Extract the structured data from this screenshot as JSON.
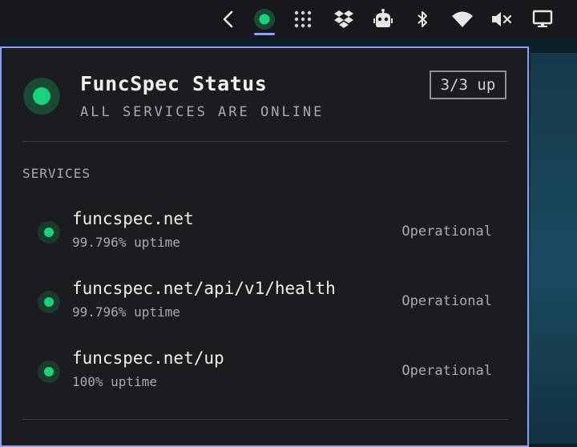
{
  "topbar": {
    "icons": [
      "chevron-left-icon",
      "status-dot-icon",
      "grid-dots-icon",
      "dropbox-icon",
      "robot-icon",
      "bluetooth-icon",
      "wifi-icon",
      "volume-muted-icon",
      "monitor-icon"
    ]
  },
  "panel": {
    "title": "FuncSpec Status",
    "subtitle": "ALL SERVICES ARE ONLINE",
    "badge": "3/3 up",
    "section_label": "SERVICES",
    "services": [
      {
        "name": "funcspec.net",
        "uptime": "99.796% uptime",
        "status": "Operational"
      },
      {
        "name": "funcspec.net/api/v1/health",
        "uptime": "99.796% uptime",
        "status": "Operational"
      },
      {
        "name": "funcspec.net/up",
        "uptime": "100% uptime",
        "status": "Operational"
      }
    ]
  },
  "colors": {
    "accent": "#8aa0f5",
    "status_ok": "#1ad27a",
    "panel_bg": "#1b1c1f",
    "topbar_bg": "#17181b"
  }
}
